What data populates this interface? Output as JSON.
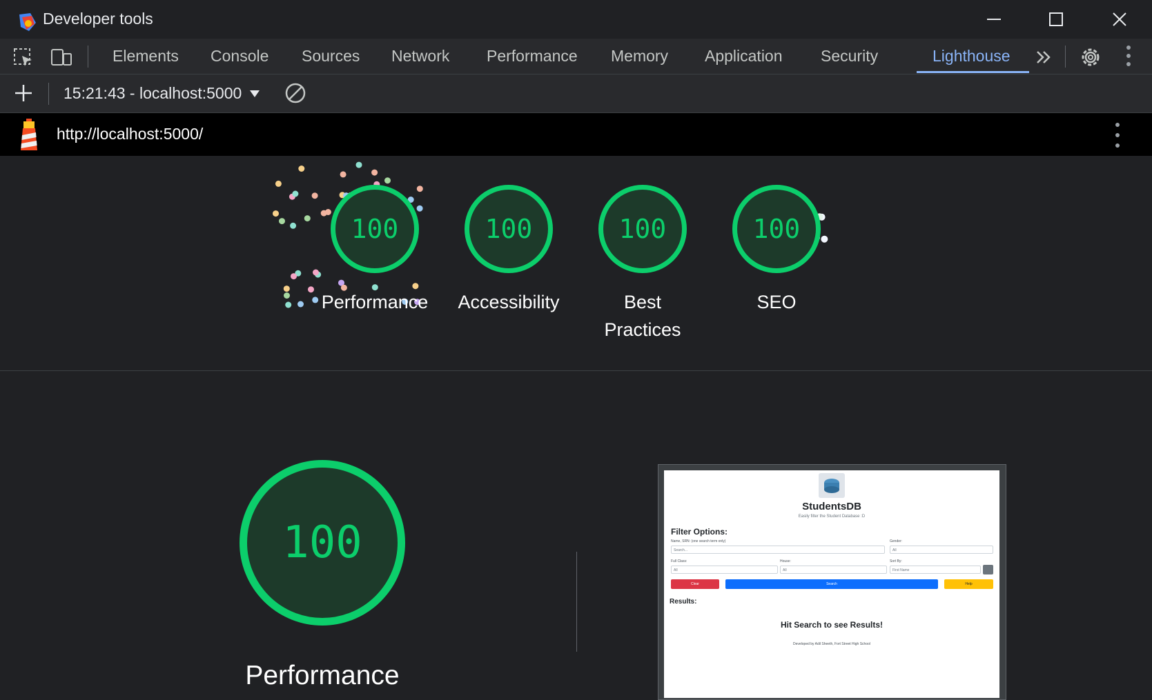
{
  "window": {
    "title": "Developer tools"
  },
  "tabs": [
    {
      "label": "Elements"
    },
    {
      "label": "Console"
    },
    {
      "label": "Sources"
    },
    {
      "label": "Network"
    },
    {
      "label": "Performance"
    },
    {
      "label": "Memory"
    },
    {
      "label": "Application"
    },
    {
      "label": "Security"
    },
    {
      "label": "Lighthouse",
      "active": true
    }
  ],
  "toolbar": {
    "report_select": "15:21:43 - localhost:5000"
  },
  "report": {
    "url": "http://localhost:5000/"
  },
  "scores": [
    {
      "label": "Performance",
      "value": "100"
    },
    {
      "label": "Accessibility",
      "value": "100"
    },
    {
      "label": "Best Practices",
      "value": "100"
    },
    {
      "label": "SEO",
      "value": "100"
    }
  ],
  "performance_detail": {
    "score": "100",
    "label": "Performance"
  },
  "screenshot": {
    "app_title": "StudentsDB",
    "subtitle": "Easily filter the Student Database :D",
    "filter_heading": "Filter Options:",
    "name_label": "Name, SRN: (one search term only)",
    "name_placeholder": "Search...",
    "gender_label": "Gender:",
    "gender_value": "All",
    "class_label": "Full Class:",
    "class_value": "All",
    "house_label": "House:",
    "house_value": "All",
    "sort_label": "Sort By:",
    "sort_value": "First Name",
    "clear_label": "Clear",
    "search_label": "Search",
    "help_label": "Help",
    "results_heading": "Results:",
    "hint": "Hit Search to see Results!",
    "footer": "Developed by Adil Sheeth, Fort Street High School"
  },
  "colors": {
    "accent": "#8ab4f8",
    "score_pass": "#0cce6b",
    "btn_danger": "#dc3545",
    "btn_primary": "#0d6efd",
    "btn_warning": "#ffc107"
  }
}
